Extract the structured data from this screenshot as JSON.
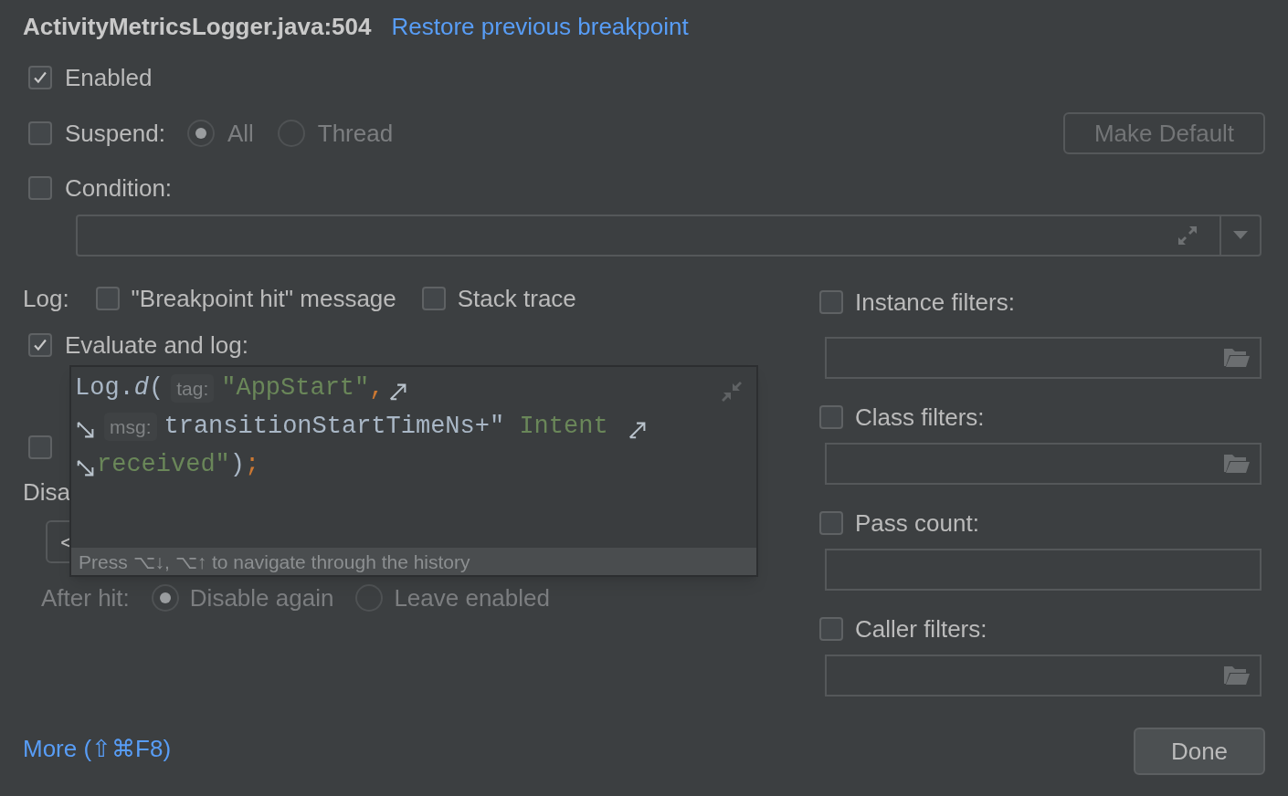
{
  "header": {
    "title": "ActivityMetricsLogger.java:504",
    "link": "Restore previous breakpoint"
  },
  "enabled": {
    "label": "Enabled",
    "checked": true
  },
  "suspend": {
    "label": "Suspend:",
    "checked": false,
    "options": [
      {
        "label": "All",
        "selected": true,
        "disabled": true
      },
      {
        "label": "Thread",
        "selected": false,
        "disabled": true
      }
    ]
  },
  "make_default_button": {
    "label": "Make Default",
    "disabled": true
  },
  "condition": {
    "label": "Condition:",
    "checked": false
  },
  "log": {
    "label": "Log:",
    "options": [
      {
        "label": "\"Breakpoint hit\" message",
        "checked": false
      },
      {
        "label": "Stack trace",
        "checked": false
      }
    ]
  },
  "evaluate": {
    "label": "Evaluate and log:",
    "checked": true
  },
  "partial_option": {
    "checked": false
  },
  "disable_label": "Disa",
  "dependency_field": {
    "value": "<"
  },
  "after_hit": {
    "label": "After hit:",
    "disabled": true,
    "options": [
      {
        "label": "Disable again",
        "selected": true
      },
      {
        "label": "Leave enabled",
        "selected": false
      }
    ]
  },
  "more_link": "More (⇧⌘F8)",
  "filters": [
    {
      "label": "Instance filters:",
      "checked": false,
      "browse": true
    },
    {
      "label": "Class filters:",
      "checked": false,
      "browse": true
    },
    {
      "label": "Pass count:",
      "checked": false,
      "browse": false
    },
    {
      "label": "Caller filters:",
      "checked": false,
      "browse": true
    }
  ],
  "done_button": {
    "label": "Done"
  },
  "expression_popup": {
    "lines": [
      [
        {
          "kind": "plain",
          "text": "Log."
        },
        {
          "kind": "method",
          "text": "d"
        },
        {
          "kind": "plain",
          "text": "("
        },
        {
          "kind": "hint",
          "text": "tag:"
        },
        {
          "kind": "string",
          "text": "\"AppStart\""
        },
        {
          "kind": "punct",
          "text": ","
        },
        {
          "kind": "wrap_end"
        }
      ],
      [
        {
          "kind": "wrap_start"
        },
        {
          "kind": "hint",
          "text": "msg:"
        },
        {
          "kind": "plain",
          "text": "transitionStartTimeNs+\""
        },
        {
          "kind": "string",
          "text": " Intent "
        },
        {
          "kind": "wrap_end"
        }
      ],
      [
        {
          "kind": "wrap_start"
        },
        {
          "kind": "string",
          "text": "received\""
        },
        {
          "kind": "plain",
          "text": ")"
        },
        {
          "kind": "punct",
          "text": ";"
        }
      ]
    ],
    "hint": "Press ⌥↓, ⌥↑ to navigate through the history"
  }
}
